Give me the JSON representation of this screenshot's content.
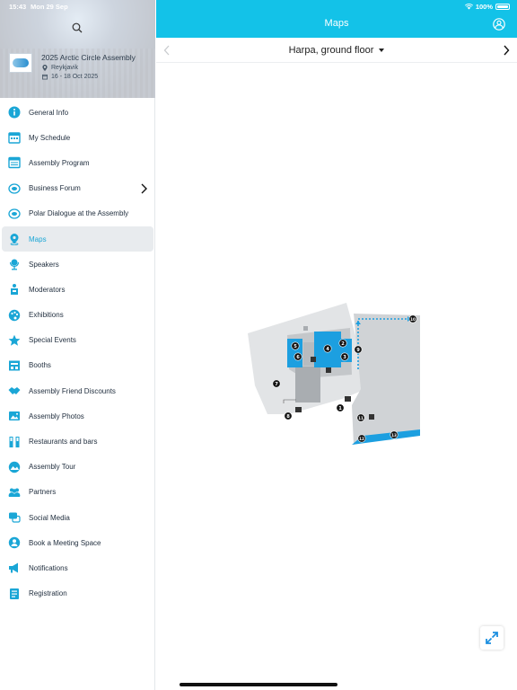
{
  "status": {
    "time": "15:43",
    "date": "Mon 29 Sep",
    "battery": "100%"
  },
  "event": {
    "title": "2025 Arctic Circle Assembly",
    "location": "Reykjavik",
    "dates": "16 - 18 Oct 2025"
  },
  "menu": [
    {
      "label": "General Info",
      "icon": "info-icon"
    },
    {
      "label": "My Schedule",
      "icon": "schedule-icon"
    },
    {
      "label": "Assembly Program",
      "icon": "program-icon"
    },
    {
      "label": "Business Forum",
      "icon": "forum-icon"
    },
    {
      "label": "Polar Dialogue at the Assembly",
      "icon": "dialogue-icon"
    },
    {
      "label": "Maps",
      "icon": "map-pin-icon"
    },
    {
      "label": "Speakers",
      "icon": "microphone-icon"
    },
    {
      "label": "Moderators",
      "icon": "moderator-icon"
    },
    {
      "label": "Exhibitions",
      "icon": "palette-icon"
    },
    {
      "label": "Special Events",
      "icon": "star-icon"
    },
    {
      "label": "Booths",
      "icon": "booth-icon"
    },
    {
      "label": "Assembly Friend Discounts",
      "icon": "handshake-icon"
    },
    {
      "label": "Assembly Photos",
      "icon": "photo-icon"
    },
    {
      "label": "Restaurants and bars",
      "icon": "restaurant-icon"
    },
    {
      "label": "Assembly Tour",
      "icon": "tour-icon"
    },
    {
      "label": "Partners",
      "icon": "partners-icon"
    },
    {
      "label": "Social Media",
      "icon": "social-icon"
    },
    {
      "label": "Book a Meeting Space",
      "icon": "meeting-icon"
    },
    {
      "label": "Notifications",
      "icon": "megaphone-icon"
    },
    {
      "label": "Registration",
      "icon": "registration-icon"
    }
  ],
  "main": {
    "title": "Maps",
    "floor": "Harpa, ground floor"
  },
  "map_labels": [
    "1",
    "3",
    "4",
    "5",
    "6",
    "7",
    "8",
    "9",
    "10",
    "11",
    "12",
    "13",
    "2"
  ],
  "colors": {
    "accent": "#13c2e8",
    "map_blue": "#1c9fe0",
    "map_grey": "#d8dadd",
    "map_dark": "#a9adb1"
  }
}
